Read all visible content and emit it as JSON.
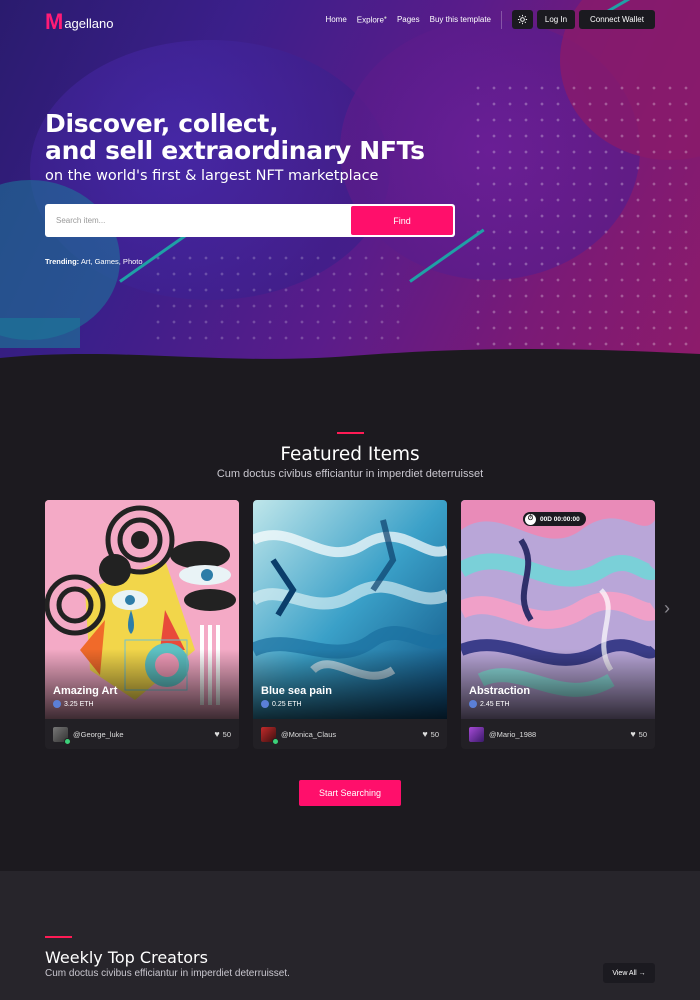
{
  "brand": {
    "logo_letter": "M",
    "logo_text": "agellano",
    "accent": "#ff0f6b"
  },
  "nav": {
    "links": [
      "Home",
      "Explore",
      "Pages",
      "Buy this template"
    ],
    "login": "Log In",
    "connect_wallet": "Connect Wallet",
    "theme_icon": "sun-icon"
  },
  "hero": {
    "title_line1": "Discover, collect,",
    "title_line2": "and sell extraordinary NFTs",
    "subtitle": "on the world's first & largest NFT marketplace",
    "search_placeholder": "Search item...",
    "find_label": "Find",
    "trending_label": "Trending:",
    "trending_items": "Art, Games, Photo"
  },
  "featured": {
    "title": "Featured Items",
    "subtitle": "Cum doctus civibus efficiantur in imperdiet deterruisset",
    "items": [
      {
        "title": "Amazing Art",
        "price": "3.25 ETH",
        "author": "@George_luke",
        "likes": "50"
      },
      {
        "title": "Blue sea pain",
        "price": "0.25 ETH",
        "author": "@Monica_Claus",
        "likes": "50"
      },
      {
        "title": "Abstraction",
        "price": "2.45 ETH",
        "author": "@Mario_1988",
        "likes": "50",
        "timer": "00D 00:00:00"
      }
    ],
    "start_button": "Start Searching"
  },
  "creators": {
    "title": "Weekly Top Creators",
    "subtitle": "Cum doctus civibus efficiantur in imperdiet deterruisset.",
    "view_all": "View All →"
  }
}
